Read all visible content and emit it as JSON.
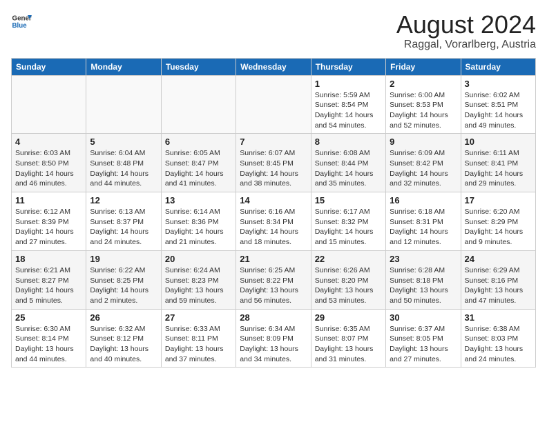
{
  "header": {
    "logo": {
      "general": "General",
      "blue": "Blue"
    },
    "title": "August 2024",
    "subtitle": "Raggal, Vorarlberg, Austria"
  },
  "calendar": {
    "headers": [
      "Sunday",
      "Monday",
      "Tuesday",
      "Wednesday",
      "Thursday",
      "Friday",
      "Saturday"
    ],
    "weeks": [
      [
        {
          "day": "",
          "info": ""
        },
        {
          "day": "",
          "info": ""
        },
        {
          "day": "",
          "info": ""
        },
        {
          "day": "",
          "info": ""
        },
        {
          "day": "1",
          "info": "Sunrise: 5:59 AM\nSunset: 8:54 PM\nDaylight: 14 hours and 54 minutes."
        },
        {
          "day": "2",
          "info": "Sunrise: 6:00 AM\nSunset: 8:53 PM\nDaylight: 14 hours and 52 minutes."
        },
        {
          "day": "3",
          "info": "Sunrise: 6:02 AM\nSunset: 8:51 PM\nDaylight: 14 hours and 49 minutes."
        }
      ],
      [
        {
          "day": "4",
          "info": "Sunrise: 6:03 AM\nSunset: 8:50 PM\nDaylight: 14 hours and 46 minutes."
        },
        {
          "day": "5",
          "info": "Sunrise: 6:04 AM\nSunset: 8:48 PM\nDaylight: 14 hours and 44 minutes."
        },
        {
          "day": "6",
          "info": "Sunrise: 6:05 AM\nSunset: 8:47 PM\nDaylight: 14 hours and 41 minutes."
        },
        {
          "day": "7",
          "info": "Sunrise: 6:07 AM\nSunset: 8:45 PM\nDaylight: 14 hours and 38 minutes."
        },
        {
          "day": "8",
          "info": "Sunrise: 6:08 AM\nSunset: 8:44 PM\nDaylight: 14 hours and 35 minutes."
        },
        {
          "day": "9",
          "info": "Sunrise: 6:09 AM\nSunset: 8:42 PM\nDaylight: 14 hours and 32 minutes."
        },
        {
          "day": "10",
          "info": "Sunrise: 6:11 AM\nSunset: 8:41 PM\nDaylight: 14 hours and 29 minutes."
        }
      ],
      [
        {
          "day": "11",
          "info": "Sunrise: 6:12 AM\nSunset: 8:39 PM\nDaylight: 14 hours and 27 minutes."
        },
        {
          "day": "12",
          "info": "Sunrise: 6:13 AM\nSunset: 8:37 PM\nDaylight: 14 hours and 24 minutes."
        },
        {
          "day": "13",
          "info": "Sunrise: 6:14 AM\nSunset: 8:36 PM\nDaylight: 14 hours and 21 minutes."
        },
        {
          "day": "14",
          "info": "Sunrise: 6:16 AM\nSunset: 8:34 PM\nDaylight: 14 hours and 18 minutes."
        },
        {
          "day": "15",
          "info": "Sunrise: 6:17 AM\nSunset: 8:32 PM\nDaylight: 14 hours and 15 minutes."
        },
        {
          "day": "16",
          "info": "Sunrise: 6:18 AM\nSunset: 8:31 PM\nDaylight: 14 hours and 12 minutes."
        },
        {
          "day": "17",
          "info": "Sunrise: 6:20 AM\nSunset: 8:29 PM\nDaylight: 14 hours and 9 minutes."
        }
      ],
      [
        {
          "day": "18",
          "info": "Sunrise: 6:21 AM\nSunset: 8:27 PM\nDaylight: 14 hours and 5 minutes."
        },
        {
          "day": "19",
          "info": "Sunrise: 6:22 AM\nSunset: 8:25 PM\nDaylight: 14 hours and 2 minutes."
        },
        {
          "day": "20",
          "info": "Sunrise: 6:24 AM\nSunset: 8:23 PM\nDaylight: 13 hours and 59 minutes."
        },
        {
          "day": "21",
          "info": "Sunrise: 6:25 AM\nSunset: 8:22 PM\nDaylight: 13 hours and 56 minutes."
        },
        {
          "day": "22",
          "info": "Sunrise: 6:26 AM\nSunset: 8:20 PM\nDaylight: 13 hours and 53 minutes."
        },
        {
          "day": "23",
          "info": "Sunrise: 6:28 AM\nSunset: 8:18 PM\nDaylight: 13 hours and 50 minutes."
        },
        {
          "day": "24",
          "info": "Sunrise: 6:29 AM\nSunset: 8:16 PM\nDaylight: 13 hours and 47 minutes."
        }
      ],
      [
        {
          "day": "25",
          "info": "Sunrise: 6:30 AM\nSunset: 8:14 PM\nDaylight: 13 hours and 44 minutes."
        },
        {
          "day": "26",
          "info": "Sunrise: 6:32 AM\nSunset: 8:12 PM\nDaylight: 13 hours and 40 minutes."
        },
        {
          "day": "27",
          "info": "Sunrise: 6:33 AM\nSunset: 8:11 PM\nDaylight: 13 hours and 37 minutes."
        },
        {
          "day": "28",
          "info": "Sunrise: 6:34 AM\nSunset: 8:09 PM\nDaylight: 13 hours and 34 minutes."
        },
        {
          "day": "29",
          "info": "Sunrise: 6:35 AM\nSunset: 8:07 PM\nDaylight: 13 hours and 31 minutes."
        },
        {
          "day": "30",
          "info": "Sunrise: 6:37 AM\nSunset: 8:05 PM\nDaylight: 13 hours and 27 minutes."
        },
        {
          "day": "31",
          "info": "Sunrise: 6:38 AM\nSunset: 8:03 PM\nDaylight: 13 hours and 24 minutes."
        }
      ]
    ]
  }
}
